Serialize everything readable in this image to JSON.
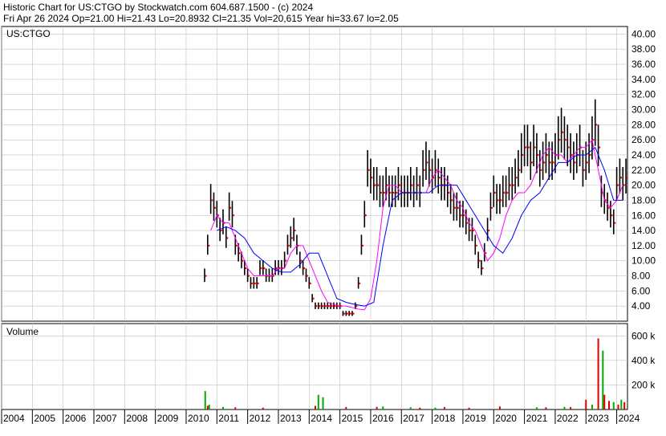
{
  "header": {
    "line1": "Historic Chart for US:CTGO by Stockwatch.com 604.687.1500 - (c) 2024",
    "line2": "Fri Apr 26 2024   Op=21.00   Hi=21.43   Lo=20.8932   Cl=21.35   Vol=20,615   Year hi=33.67   lo=2.05"
  },
  "colors": {
    "price_bar": "#000000",
    "close_dot": "#ff0000",
    "ma_short": "#ff00ff",
    "ma_long": "#0000ff",
    "vol_up": "#00aa00",
    "vol_down": "#dd0000",
    "grid": "#c0c0c0"
  },
  "chart_data": [
    {
      "type": "line",
      "panel_label": "US:CTGO",
      "y_ticks": [
        "40.00",
        "38.00",
        "36.00",
        "34.00",
        "32.00",
        "30.00",
        "28.00",
        "26.00",
        "24.00",
        "22.00",
        "20.00",
        "18.00",
        "16.00",
        "14.00",
        "12.00",
        "10.00",
        "8.00",
        "6.00",
        "4.00"
      ],
      "ylim": [
        2,
        41
      ],
      "x_ticks": [
        "2004",
        "2005",
        "2006",
        "2007",
        "2008",
        "2009",
        "2010",
        "2011",
        "2012",
        "2013",
        "2014",
        "2015",
        "2016",
        "2017",
        "2018",
        "2019",
        "2020",
        "2021",
        "2022",
        "2023",
        "2024"
      ],
      "xlim": [
        2004.0,
        2024.35
      ],
      "grid": true,
      "series": [
        {
          "role": "price",
          "x": [
            2010.6,
            2010.7,
            2010.8,
            2010.9,
            2011.0,
            2011.1,
            2011.2,
            2011.3,
            2011.4,
            2011.5,
            2011.6,
            2011.7,
            2011.8,
            2011.9,
            2012.0,
            2012.1,
            2012.2,
            2012.3,
            2012.4,
            2012.5,
            2012.6,
            2012.7,
            2012.8,
            2012.9,
            2013.0,
            2013.1,
            2013.2,
            2013.3,
            2013.4,
            2013.5,
            2013.6,
            2013.7,
            2013.8,
            2013.9,
            2014.0,
            2014.1,
            2014.2,
            2014.3,
            2014.4,
            2014.5,
            2014.6,
            2014.7,
            2014.8,
            2014.9,
            2015.0,
            2015.1,
            2015.2,
            2015.3,
            2015.4,
            2015.5,
            2015.6,
            2015.7,
            2015.8,
            2015.9,
            2016.0,
            2016.1,
            2016.2,
            2016.3,
            2016.4,
            2016.5,
            2016.6,
            2016.7,
            2016.8,
            2016.9,
            2017.0,
            2017.1,
            2017.2,
            2017.3,
            2017.4,
            2017.5,
            2017.6,
            2017.7,
            2017.8,
            2017.9,
            2018.0,
            2018.1,
            2018.2,
            2018.3,
            2018.4,
            2018.5,
            2018.6,
            2018.7,
            2018.8,
            2018.9,
            2019.0,
            2019.1,
            2019.2,
            2019.3,
            2019.4,
            2019.5,
            2019.6,
            2019.7,
            2019.8,
            2019.9,
            2020.0,
            2020.1,
            2020.2,
            2020.3,
            2020.4,
            2020.5,
            2020.6,
            2020.7,
            2020.8,
            2020.9,
            2021.0,
            2021.1,
            2021.2,
            2021.3,
            2021.4,
            2021.5,
            2021.6,
            2021.7,
            2021.8,
            2021.9,
            2022.0,
            2022.1,
            2022.2,
            2022.3,
            2022.4,
            2022.5,
            2022.6,
            2022.7,
            2022.8,
            2022.9,
            2023.0,
            2023.1,
            2023.2,
            2023.3,
            2023.4,
            2023.5,
            2023.6,
            2023.7,
            2023.8,
            2023.9,
            2024.0,
            2024.1,
            2024.2,
            2024.3
          ],
          "y": [
            8,
            12,
            18,
            17,
            16,
            14,
            15,
            13,
            17,
            16,
            12,
            11,
            10,
            9,
            8,
            7,
            7,
            7,
            9,
            9,
            8,
            8,
            8,
            9,
            9,
            9,
            10,
            12,
            13,
            14,
            12,
            10,
            9,
            8,
            7,
            5,
            4,
            4,
            4,
            4,
            4,
            4,
            4,
            4,
            4,
            3,
            3,
            3,
            3,
            4,
            7,
            12,
            16,
            22,
            21,
            20,
            20,
            19,
            19,
            20,
            19,
            19,
            19,
            20,
            19,
            19,
            19,
            20,
            19,
            20,
            19,
            22,
            23,
            22,
            21,
            22,
            21,
            20,
            20,
            19,
            18,
            17,
            17,
            16,
            16,
            15,
            14,
            14,
            12,
            10,
            9,
            11,
            14,
            17,
            19,
            18,
            18,
            19,
            19,
            20,
            20,
            21,
            22,
            24,
            25,
            25,
            23,
            25,
            24,
            22,
            23,
            24,
            23,
            23,
            24,
            26,
            27,
            26,
            25,
            24,
            23,
            24,
            25,
            22,
            23,
            24,
            26,
            28,
            25,
            19,
            18,
            17,
            16,
            15,
            20,
            21,
            20,
            21
          ]
        },
        {
          "role": "ma_short",
          "x": [
            2010.8,
            2011.0,
            2011.2,
            2011.4,
            2011.6,
            2011.8,
            2012.0,
            2012.2,
            2012.4,
            2012.6,
            2012.8,
            2013.0,
            2013.2,
            2013.4,
            2013.6,
            2013.8,
            2014.0,
            2014.2,
            2014.4,
            2014.6,
            2014.8,
            2015.0,
            2015.2,
            2015.4,
            2015.6,
            2015.8,
            2016.0,
            2016.2,
            2016.4,
            2016.6,
            2016.8,
            2017.0,
            2017.2,
            2017.4,
            2017.6,
            2017.8,
            2018.0,
            2018.2,
            2018.4,
            2018.6,
            2018.8,
            2019.0,
            2019.2,
            2019.4,
            2019.6,
            2019.8,
            2020.0,
            2020.2,
            2020.4,
            2020.6,
            2020.8,
            2021.0,
            2021.2,
            2021.4,
            2021.6,
            2021.8,
            2022.0,
            2022.2,
            2022.4,
            2022.6,
            2022.8,
            2023.0,
            2023.2,
            2023.4,
            2023.6,
            2023.8,
            2024.0,
            2024.2
          ],
          "y": [
            14,
            16,
            15,
            15,
            13,
            11,
            9,
            8,
            8,
            8,
            8,
            9,
            9,
            11,
            12,
            12,
            10,
            8,
            6,
            4.5,
            4.2,
            4,
            4,
            3.8,
            3.6,
            3.5,
            5,
            10,
            17,
            20,
            20,
            19,
            19,
            19,
            19,
            19,
            21,
            22,
            21,
            20,
            18,
            17,
            15,
            14,
            12,
            10,
            11,
            13,
            16,
            18,
            19,
            19,
            20,
            22,
            24,
            25,
            24,
            24,
            23,
            24,
            25,
            25,
            26,
            22,
            18,
            17,
            18,
            20
          ]
        },
        {
          "role": "ma_long",
          "x": [
            2011.0,
            2011.3,
            2011.6,
            2011.9,
            2012.2,
            2012.5,
            2012.8,
            2013.1,
            2013.4,
            2013.7,
            2014.0,
            2014.3,
            2014.6,
            2014.9,
            2015.2,
            2015.5,
            2015.8,
            2016.1,
            2016.4,
            2016.7,
            2017.0,
            2017.3,
            2017.6,
            2017.9,
            2018.2,
            2018.5,
            2018.8,
            2019.1,
            2019.4,
            2019.7,
            2020.0,
            2020.3,
            2020.6,
            2020.9,
            2021.2,
            2021.5,
            2021.8,
            2022.1,
            2022.4,
            2022.7,
            2023.0,
            2023.3,
            2023.6,
            2023.9,
            2024.2
          ],
          "y": [
            14,
            14.5,
            14,
            13,
            11,
            10,
            9,
            8.5,
            8.5,
            9.5,
            11,
            11,
            8,
            5,
            4.5,
            4.2,
            4,
            4.5,
            12,
            18,
            19,
            19,
            19,
            19,
            20,
            20,
            20,
            18,
            16,
            14,
            12,
            11,
            13,
            16,
            18,
            19,
            21,
            23,
            23,
            24,
            24,
            25,
            22,
            18,
            18
          ]
        }
      ]
    },
    {
      "type": "bar",
      "panel_label": "Volume",
      "y_ticks": [
        "600 k",
        "400 k",
        "200 k"
      ],
      "ylim": [
        0,
        700
      ],
      "series": [
        {
          "role": "volume_up",
          "x": [
            2010.62,
            2010.75,
            2011.2,
            2014.3,
            2014.45,
            2016.4,
            2017.3,
            2018.1,
            2021.4,
            2022.3,
            2023.2,
            2023.55,
            2023.9,
            2024.15
          ],
          "values": [
            150,
            40,
            20,
            120,
            100,
            25,
            18,
            15,
            18,
            22,
            40,
            480,
            60,
            80
          ]
        },
        {
          "role": "volume_down",
          "x": [
            2010.7,
            2011.6,
            2012.5,
            2014.2,
            2015.2,
            2016.2,
            2017.6,
            2018.4,
            2019.2,
            2020.2,
            2021.7,
            2022.5,
            2023.0,
            2023.4,
            2023.6,
            2023.75,
            2024.05,
            2024.25
          ],
          "values": [
            30,
            18,
            15,
            30,
            20,
            22,
            15,
            20,
            15,
            25,
            18,
            20,
            80,
            580,
            120,
            70,
            40,
            60
          ]
        }
      ]
    }
  ]
}
